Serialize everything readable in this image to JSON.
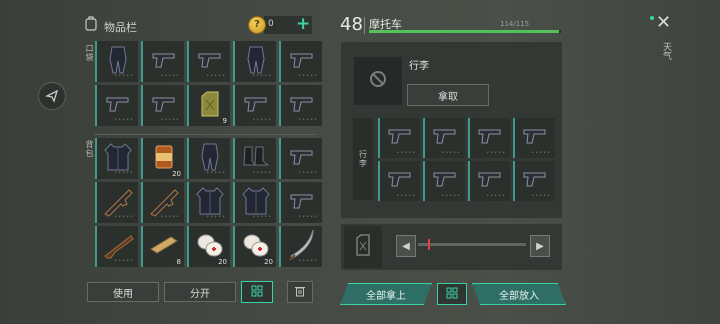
{
  "inventory": {
    "title": "物品栏",
    "coins": "0",
    "plus_label": "+",
    "pockets_label": "口袋",
    "backpack_label": "背包",
    "pocket_items": [
      {
        "icon": "vest-icon",
        "count": ""
      },
      {
        "icon": "pistol-icon",
        "count": ""
      },
      {
        "icon": "pistol-icon",
        "count": ""
      },
      {
        "icon": "vest-icon",
        "count": ""
      },
      {
        "icon": "pistol-icon",
        "count": ""
      },
      {
        "icon": "pistol-icon",
        "count": ""
      },
      {
        "icon": "pistol-icon",
        "count": ""
      },
      {
        "icon": "jerrycan-icon",
        "count": "9"
      },
      {
        "icon": "pistol-icon",
        "count": ""
      },
      {
        "icon": "pistol-icon",
        "count": ""
      }
    ],
    "backpack_items": [
      {
        "icon": "armor-icon",
        "count": ""
      },
      {
        "icon": "can-icon",
        "count": "20"
      },
      {
        "icon": "vest-icon",
        "count": ""
      },
      {
        "icon": "boots-icon",
        "count": ""
      },
      {
        "icon": "pistol-icon",
        "count": ""
      },
      {
        "icon": "rifle-icon",
        "count": ""
      },
      {
        "icon": "rifle-icon",
        "count": ""
      },
      {
        "icon": "armor-icon",
        "count": ""
      },
      {
        "icon": "armor-icon",
        "count": ""
      },
      {
        "icon": "pistol-icon",
        "count": ""
      },
      {
        "icon": "shotgun-icon",
        "count": ""
      },
      {
        "icon": "plank-icon",
        "count": "8"
      },
      {
        "icon": "bandage-icon",
        "count": "20"
      },
      {
        "icon": "bandage-icon",
        "count": "20"
      },
      {
        "icon": "scimitar-icon",
        "count": ""
      }
    ],
    "use_label": "使用",
    "split_label": "分开"
  },
  "vehicle": {
    "level": "48",
    "name": "摩托车",
    "capacity": "114/115",
    "capacity_fraction": 0.991,
    "luggage_title": "行李",
    "take_label": "拿取",
    "trunk_label": "行李",
    "trunk_items": [
      "pistol-icon",
      "pistol-icon",
      "pistol-icon",
      "pistol-icon",
      "pistol-icon",
      "pistol-icon",
      "pistol-icon",
      "pistol-icon"
    ],
    "slider_left": "◀",
    "slider_right": "▶",
    "take_all_label": "全部拿上",
    "put_all_label": "全部放入"
  },
  "top": {
    "close_label": "✕",
    "weather_label": "天气"
  },
  "colors": {
    "accent": "#3ad1a8",
    "bar": "#54c25a",
    "knob": "#e04040"
  }
}
